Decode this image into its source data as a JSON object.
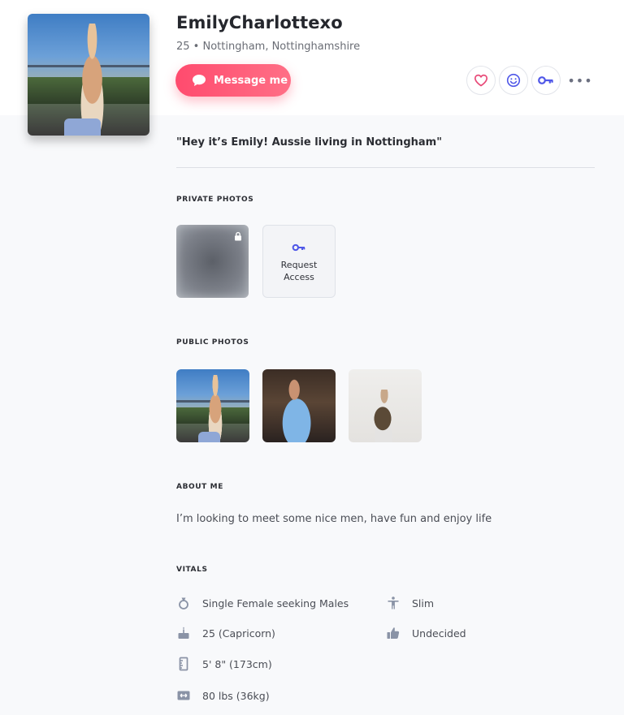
{
  "profile": {
    "username": "EmilyCharlottexo",
    "meta": "25 • Nottingham, Nottinghamshire",
    "tagline": "\"Hey it’s Emily! Aussie living in Nottingham\""
  },
  "actions": {
    "message_label": "Message me",
    "more_label": "•••"
  },
  "sections": {
    "private_photos": "PRIVATE PHOTOS",
    "public_photos": "PUBLIC PHOTOS",
    "about_me": "ABOUT ME",
    "vitals": "VITALS"
  },
  "private_photos": {
    "request_label": "Request Access"
  },
  "about": {
    "text": "I’m looking to meet some nice men, have fun and enjoy life"
  },
  "vitals": [
    {
      "icon": "gender-ring-icon",
      "label": "Single Female seeking Males"
    },
    {
      "icon": "birthday-cake-icon",
      "label": "25 (Capricorn)"
    },
    {
      "icon": "ruler-icon",
      "label": "5' 8\" (173cm)"
    },
    {
      "icon": "weight-icon",
      "label": "80 lbs (36kg)"
    },
    {
      "icon": "body-type-icon",
      "label": "Slim"
    },
    {
      "icon": "thumbs-up-icon",
      "label": "Undecided"
    }
  ],
  "colors": {
    "accent_pink": "#ff4b6e",
    "accent_blue": "#4f57e8",
    "heart_pink": "#e84a78",
    "icon_gray": "#8a93a6"
  }
}
